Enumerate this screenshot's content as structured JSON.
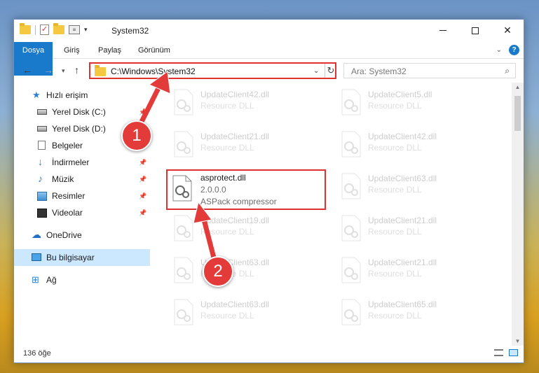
{
  "window": {
    "title": "System32",
    "controls": {
      "minimize": "–",
      "maximize": "□",
      "close": "✕"
    }
  },
  "quick_access_toolbar": {
    "caret": "▾"
  },
  "ribbon": {
    "tabs": [
      {
        "label": "Dosya"
      },
      {
        "label": "Giriş"
      },
      {
        "label": "Paylaş"
      },
      {
        "label": "Görünüm"
      }
    ],
    "collapse_icon": "⌄",
    "help_label": "?"
  },
  "navigation": {
    "back": "←",
    "forward": "→",
    "recent": "▾",
    "up": "↑",
    "address": "C:\\Windows\\System32",
    "address_dropdown": "⌄",
    "refresh": "↻",
    "search_placeholder": "Ara: System32",
    "search_icon": "⌕"
  },
  "sidebar": {
    "items": [
      {
        "label": "Hızlı erişim",
        "icon": "star-icon",
        "pin": ""
      },
      {
        "label": "Yerel Disk (C:)",
        "icon": "drive-icon",
        "pin": "📌"
      },
      {
        "label": "Yerel Disk (D:)",
        "icon": "drive-icon",
        "pin": "📌"
      },
      {
        "label": "Belgeler",
        "icon": "documents-icon",
        "pin": "📌"
      },
      {
        "label": "İndirmeler",
        "icon": "downloads-icon",
        "pin": "📌"
      },
      {
        "label": "Müzik",
        "icon": "music-icon",
        "pin": "📌"
      },
      {
        "label": "Resimler",
        "icon": "pictures-icon",
        "pin": "📌"
      },
      {
        "label": "Videolar",
        "icon": "videos-icon",
        "pin": "📌"
      },
      {
        "label": "OneDrive",
        "icon": "onedrive-icon",
        "pin": ""
      },
      {
        "label": "Bu bilgisayar",
        "icon": "this-pc-icon",
        "pin": "",
        "selected": true
      },
      {
        "label": "Ağ",
        "icon": "network-icon",
        "pin": ""
      }
    ]
  },
  "files": {
    "left_column": [
      {
        "name": "UpdateClient42.dll",
        "desc": "Resource DLL"
      },
      {
        "name": "UpdateClient21.dll",
        "desc": "Resource DLL"
      },
      {
        "name": "asprotect.dll",
        "desc": "2.0.0.0",
        "sub": "ASPack compressor",
        "highlighted": true
      },
      {
        "name": "UpdateClient19.dll",
        "desc": "Resource DLL"
      },
      {
        "name": "UpdateClient63.dll",
        "desc": "Resource DLL"
      },
      {
        "name": "UpdateClient63.dll",
        "desc": "Resource DLL"
      }
    ],
    "right_column": [
      {
        "name": "UpdateClient5.dll",
        "desc": "Resource DLL"
      },
      {
        "name": "UpdateClient42.dll",
        "desc": "Resource DLL"
      },
      {
        "name": "UpdateClient63.dll",
        "desc": "Resource DLL"
      },
      {
        "name": "UpdateClient21.dll",
        "desc": "Resource DLL"
      },
      {
        "name": "UpdateClient21.dll",
        "desc": "Resource DLL"
      },
      {
        "name": "UpdateClient65.dll",
        "desc": "Resource DLL"
      }
    ]
  },
  "status_bar": {
    "item_count": "136 öğe"
  },
  "callouts": [
    {
      "label": "1"
    },
    {
      "label": "2"
    }
  ],
  "colors": {
    "accent": "#1979ca",
    "highlight": "#e03030",
    "selection": "#cce8ff"
  }
}
